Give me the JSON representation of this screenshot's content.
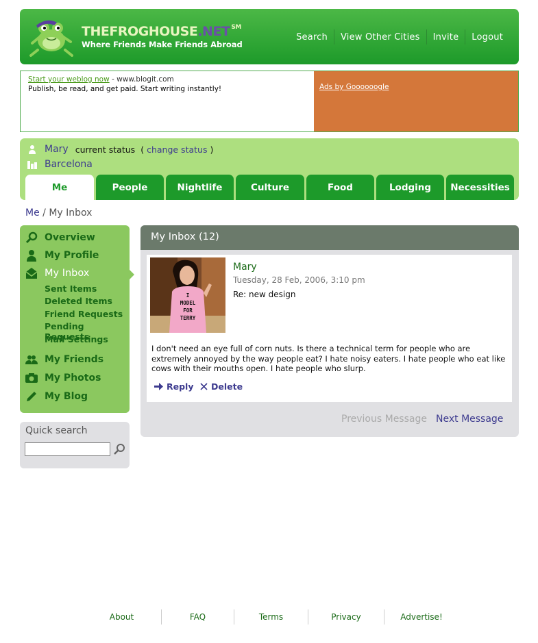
{
  "header": {
    "brand_main": "THEFROGHOUSE",
    "brand_net": ".NET",
    "brand_sm": "SM",
    "tagline": "Where Friends Make Friends Abroad",
    "nav": [
      "Search",
      "View Other Cities",
      "Invite",
      "Logout"
    ]
  },
  "ads": {
    "link": "Start your weblog now",
    "url": "- www.blogit.com",
    "desc": "Publish, be read, and get paid. Start writing instantly!",
    "google": "Ads by Goooooogle"
  },
  "user": {
    "name": "Mary",
    "status_label": "current status",
    "change_status": "change status",
    "city": "Barcelona"
  },
  "tabs": [
    "Me",
    "People",
    "Nightlife",
    "Culture",
    "Food",
    "Lodging",
    "Necessities"
  ],
  "breadcrumb": {
    "home": "Me",
    "sep": " / ",
    "current": "My Inbox"
  },
  "sidebar": {
    "items": [
      {
        "label": "Overview",
        "icon": "search-icon"
      },
      {
        "label": "My Profile",
        "icon": "person-icon"
      },
      {
        "label": "My Inbox",
        "icon": "envelope-icon"
      },
      {
        "label": "My Friends",
        "icon": "people-icon"
      },
      {
        "label": "My Photos",
        "icon": "camera-icon"
      },
      {
        "label": "My Blog",
        "icon": "pencil-icon"
      }
    ],
    "sub_items": [
      "Sent Items",
      "Deleted Items",
      "Friend Requests",
      "Pending Requests",
      "Mail Settings"
    ]
  },
  "quick_search": {
    "label": "Quick search",
    "value": ""
  },
  "inbox": {
    "title": "My Inbox (12)",
    "from": "Mary",
    "date": "Tuesday, 28 Feb, 2006, 3:10 pm",
    "subject": "Re: new design",
    "body": "I don't need an eye full of corn nuts. Is there a technical term for people who are extremely annoyed by the way people eat? I hate noisy eaters. I hate people who eat like cows with their mouths open. I hate people who slurp.",
    "reply": "Reply",
    "delete": "Delete",
    "shirt_text": "I\nMODEL\nFOR\nTERRY",
    "prev": "Previous Message",
    "next": "Next Message"
  },
  "footer": [
    "About",
    "FAQ",
    "Terms",
    "Privacy",
    "Advertise!"
  ],
  "colors": {
    "header_green": "#1d9a2a",
    "light_green": "#addf7f",
    "sidebar_green": "#8bc85f",
    "link_purple": "#3d3b8f",
    "ad_orange": "#d4773a",
    "panel_gray": "#6b7a6b"
  }
}
